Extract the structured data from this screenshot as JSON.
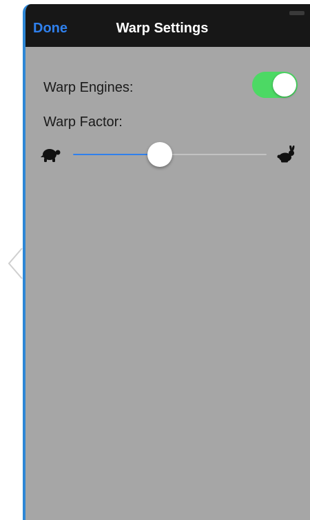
{
  "navbar": {
    "done_label": "Done",
    "title": "Warp Settings"
  },
  "settings": {
    "engines_label": "Warp Engines:",
    "engines_on": true,
    "factor_label": "Warp Factor:",
    "factor_level": 0.45
  },
  "icons": {
    "back": "chevron-left-icon",
    "slow": "turtle-icon",
    "fast": "rabbit-icon"
  },
  "colors": {
    "accent": "#2f80ed",
    "toggle_on": "#4cd964",
    "navbar_bg": "#171717",
    "content_bg": "#a6a6a6",
    "device_border": "#2e87d6"
  }
}
